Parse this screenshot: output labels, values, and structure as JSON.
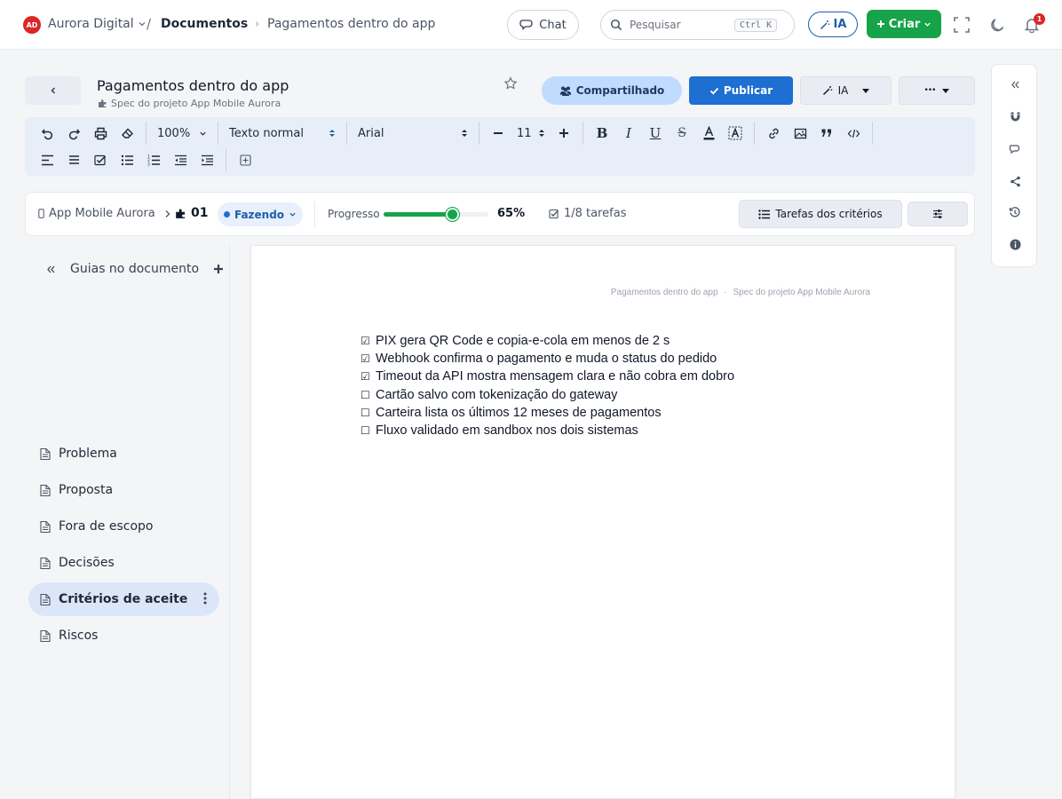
{
  "topbar": {
    "logo_text": "AD",
    "workspace": "Aurora Digital",
    "separator": "/",
    "breadcrumb_section": "Documentos",
    "breadcrumb_arrow": "›",
    "breadcrumb_page": "Pagamentos dentro do app",
    "chat_label": "Chat",
    "search_placeholder": "Pesquisar",
    "search_shortcut": "Ctrl K",
    "ia_label": "IA",
    "criar_label": "Criar",
    "notification_count": "1"
  },
  "document": {
    "title": "Pagamentos dentro do app",
    "subtitle": "Spec do projeto App Mobile Aurora",
    "shared_label": "Compartilhado",
    "publish_label": "Publicar",
    "ia_label": "IA",
    "more_label": "•••"
  },
  "toolbar": {
    "zoom": "100%",
    "style": "Texto normal",
    "font": "Arial",
    "font_size": "11"
  },
  "statusbar": {
    "app": "App Mobile Aurora",
    "number": "01",
    "status": "Fazendo",
    "progress_label": "Progresso",
    "progress_value": 65,
    "progress_text": "65%",
    "tasks": "1/8 tarefas",
    "criteria_button": "Tarefas dos critérios"
  },
  "sidebar": {
    "title": "Guias no documento",
    "items": [
      {
        "label": "Problema",
        "active": false
      },
      {
        "label": "Proposta",
        "active": false
      },
      {
        "label": "Fora de escopo",
        "active": false
      },
      {
        "label": "Decisões",
        "active": false
      },
      {
        "label": "Critérios de aceite",
        "active": true
      },
      {
        "label": "Riscos",
        "active": false
      }
    ]
  },
  "page": {
    "header_title": "Pagamentos dentro do app",
    "header_sep": "·",
    "header_sub": "Spec do projeto App Mobile Aurora",
    "checklist": [
      {
        "checked": true,
        "text": "PIX gera QR Code e copia-e-cola em menos de 2 s"
      },
      {
        "checked": true,
        "text": "Webhook confirma o pagamento e muda o status do pedido"
      },
      {
        "checked": true,
        "text": "Timeout da API mostra mensagem clara e não cobra em dobro"
      },
      {
        "checked": false,
        "text": "Cartão salvo com tokenização do gateway"
      },
      {
        "checked": false,
        "text": "Carteira lista os últimos 12 meses de pagamentos"
      },
      {
        "checked": false,
        "text": "Fluxo validado em sandbox nos dois sistemas"
      }
    ]
  },
  "colors": {
    "accent": "#1d6fd1",
    "success": "#16a34a",
    "danger": "#dc2626",
    "shared_bg": "#bfdbfe"
  }
}
